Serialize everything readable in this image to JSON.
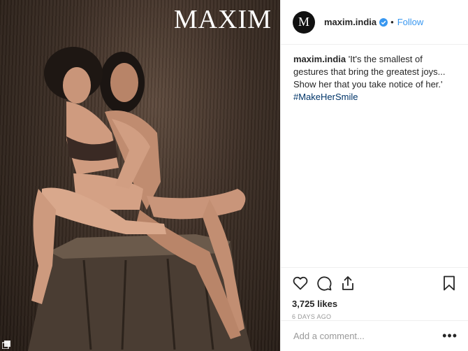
{
  "photo": {
    "masthead": "MAXIM",
    "description_icon": "carousel-badge-icon"
  },
  "header": {
    "avatar_letter": "M",
    "username": "maxim.india",
    "verified_icon": "verified-badge-icon",
    "separator": "•",
    "follow_label": "Follow"
  },
  "caption": {
    "username": "maxim.india",
    "text": " 'It's the smallest of gestures that bring the greatest joys... Show her that you take notice of her.' ",
    "hashtag": "#MakeHerSmile"
  },
  "actions": {
    "like_icon": "heart-icon",
    "comment_icon": "comment-icon",
    "share_icon": "share-icon",
    "save_icon": "bookmark-icon"
  },
  "likes": "3,725 likes",
  "timestamp": "6 DAYS AGO",
  "comment": {
    "placeholder": "Add a comment...",
    "more_label": "•••"
  },
  "colors": {
    "link": "#3897f0",
    "hashtag": "#003569",
    "muted": "#999999",
    "text": "#262626",
    "border": "#efefef"
  }
}
